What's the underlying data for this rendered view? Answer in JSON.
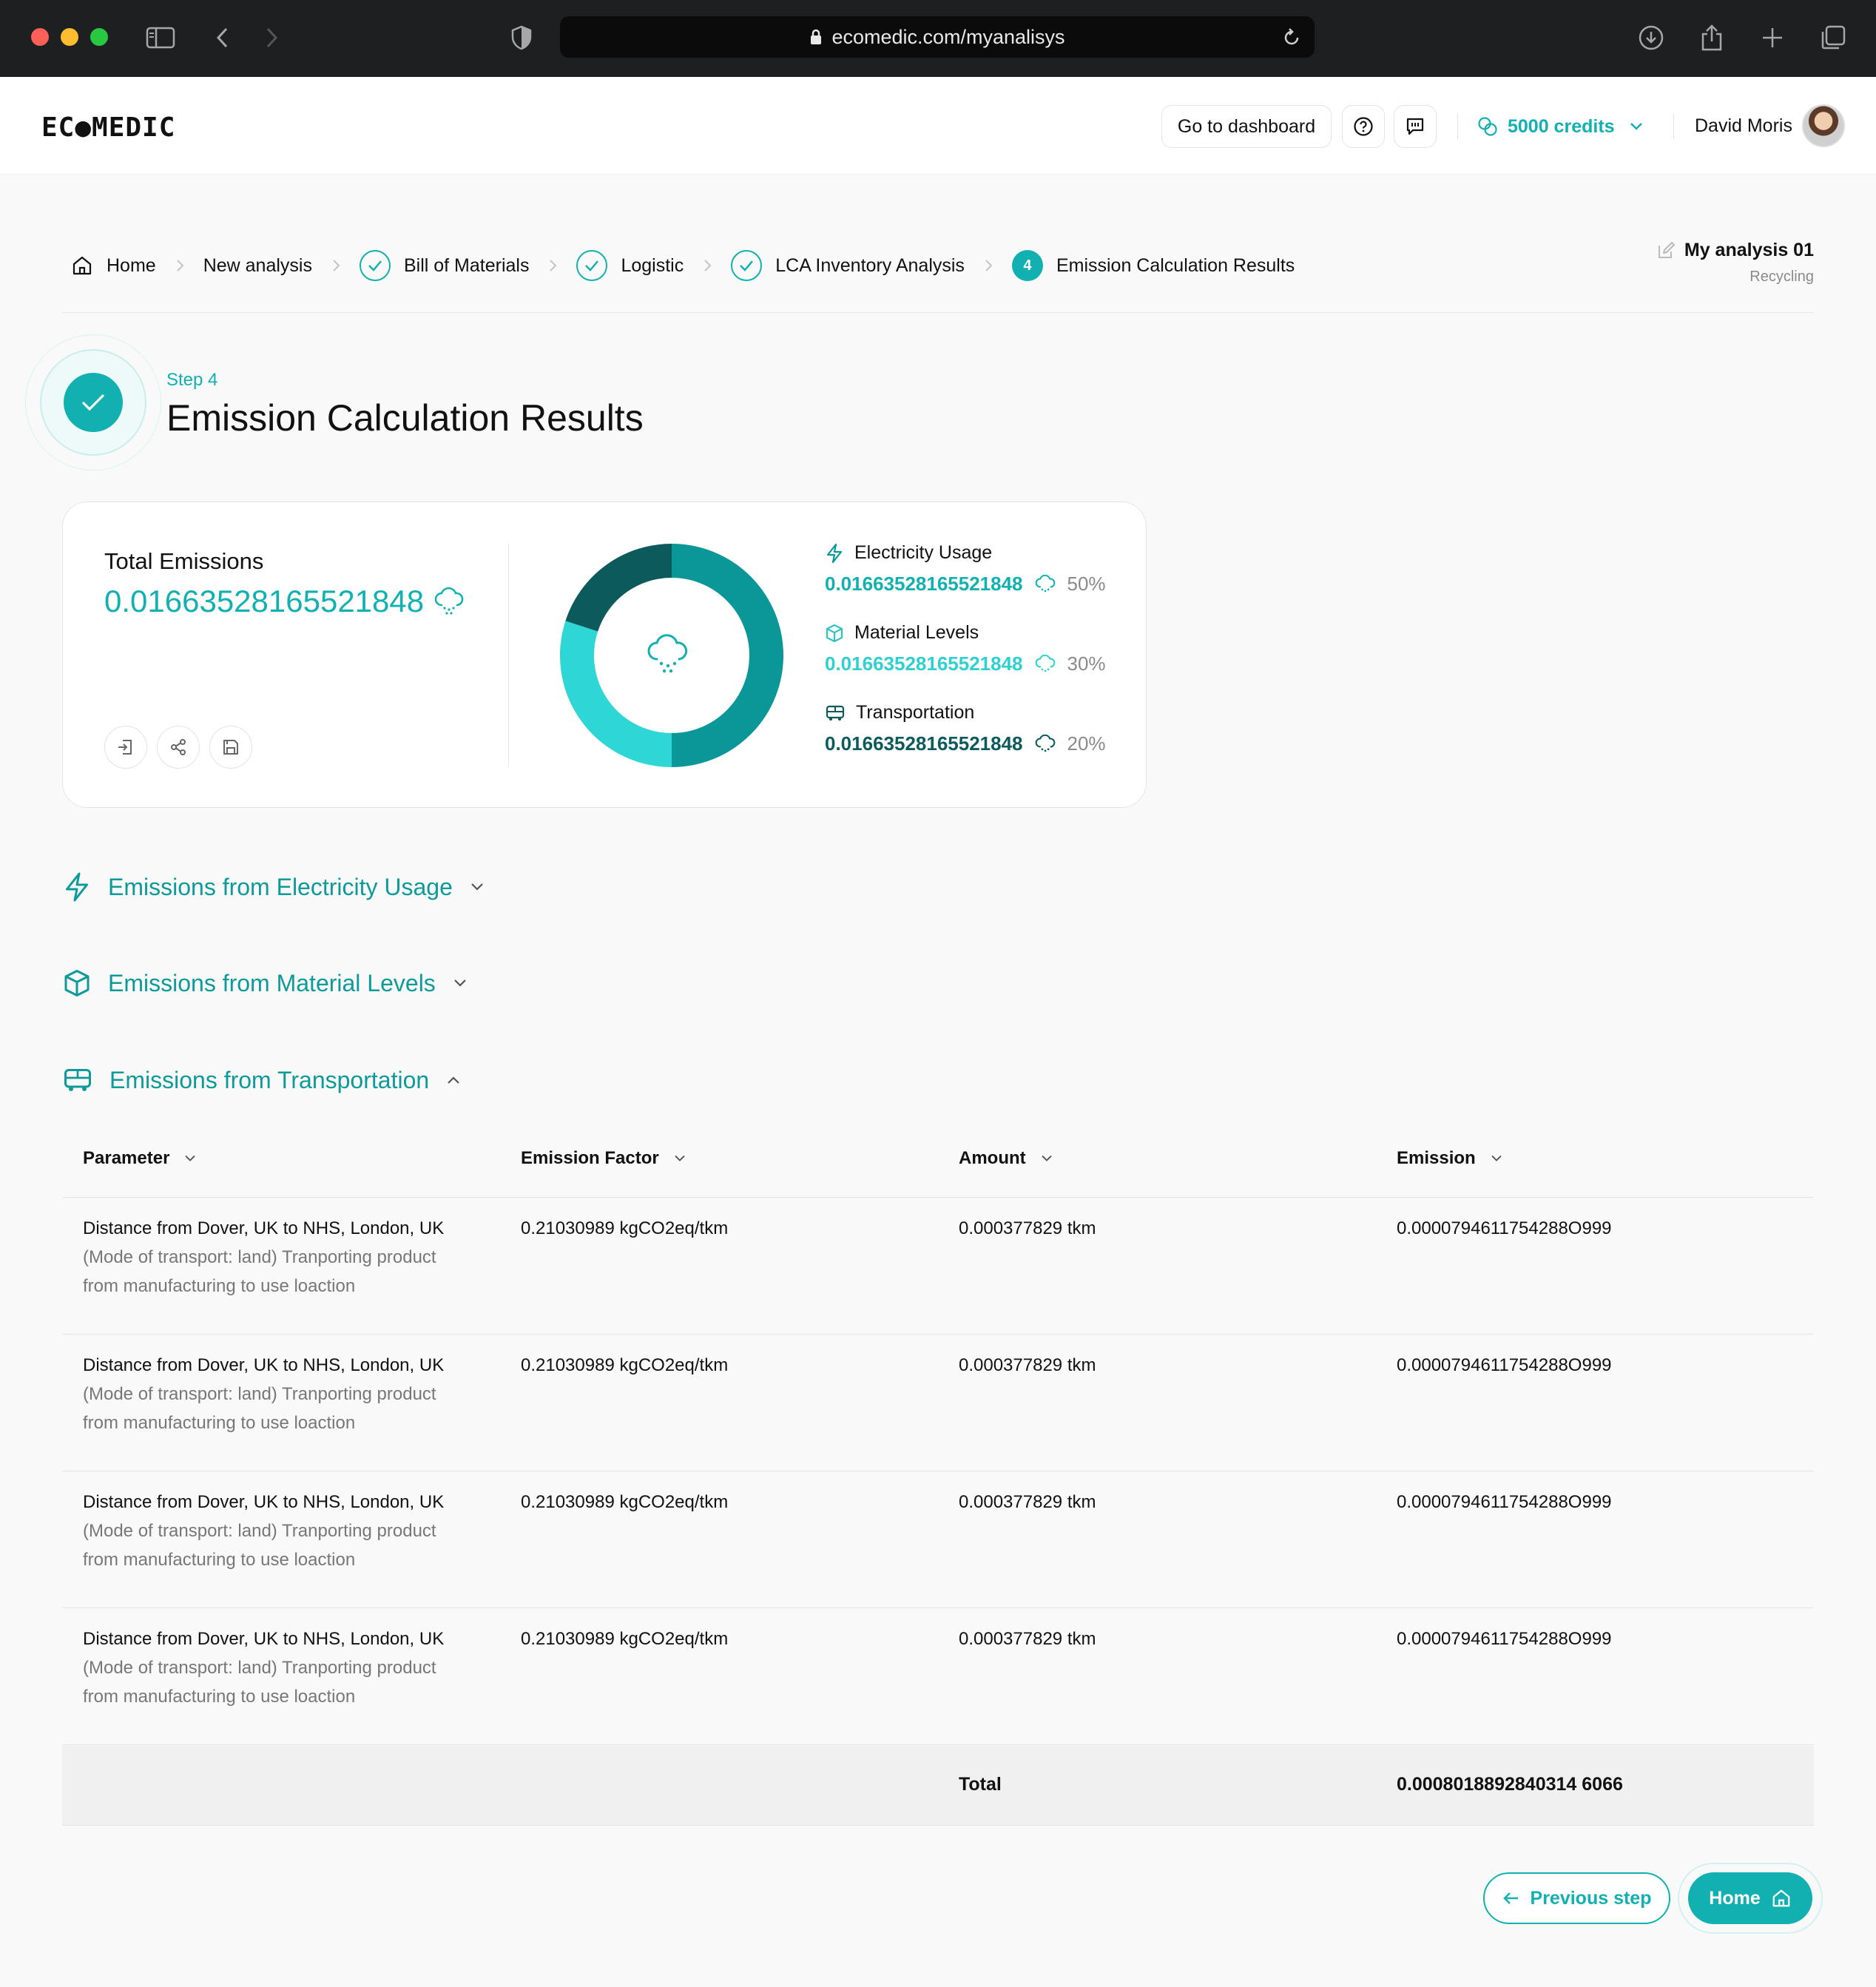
{
  "browser": {
    "url": "ecomedic.com/myanalisys"
  },
  "header": {
    "logo": "EC●MEDIC",
    "dashboard_button": "Go to dashboard",
    "credits": "5000 credits",
    "user_name": "David Moris"
  },
  "breadcrumb": {
    "items": [
      {
        "label": "Home",
        "state": "home"
      },
      {
        "label": "New analysis",
        "state": "plain"
      },
      {
        "label": "Bill of Materials",
        "state": "done"
      },
      {
        "label": "Logistic",
        "state": "done"
      },
      {
        "label": "LCA Inventory Analysis",
        "state": "done"
      },
      {
        "label": "Emission Calculation Results",
        "state": "current",
        "number": "4"
      }
    ],
    "analysis_name": "My analysis 01",
    "analysis_type": "Recycling"
  },
  "step": {
    "label": "Step 4",
    "title": "Emission Calculation Results"
  },
  "summary": {
    "total_label": "Total Emissions",
    "total_value": "0.01663528165521848",
    "breakdown": [
      {
        "name": "Electricity Usage",
        "value": "0.01663528165521848",
        "percent": "50%",
        "share": 0.5,
        "color": "#0b9797",
        "icon": "bolt-icon"
      },
      {
        "name": "Material Levels",
        "value": "0.01663528165521848",
        "percent": "30%",
        "share": 0.3,
        "color": "#2fd6d6",
        "icon": "cube-icon"
      },
      {
        "name": "Transportation",
        "value": "0.01663528165521848",
        "percent": "20%",
        "share": 0.2,
        "color": "#0d5a5d",
        "icon": "bus-icon"
      }
    ]
  },
  "sections": {
    "electricity": "Emissions from Electricity Usage",
    "material": "Emissions from Material Levels",
    "transportation": "Emissions from Transportation"
  },
  "table": {
    "headers": [
      "Parameter",
      "Emission Factor",
      "Amount",
      "Emission"
    ],
    "rows": [
      {
        "name": "Distance from Dover, UK to NHS, London, UK",
        "desc1": "(Mode of transport: land) Tranporting product",
        "desc2": "from manufacturing to use loaction",
        "factor": "0.21030989 kgCO2eq/tkm",
        "amount": "0.000377829 tkm",
        "emission": "0.0000794611754288O999"
      },
      {
        "name": "Distance from Dover, UK to NHS, London, UK",
        "desc1": "(Mode of transport: land) Tranporting product",
        "desc2": "from manufacturing to use loaction",
        "factor": "0.21030989 kgCO2eq/tkm",
        "amount": "0.000377829 tkm",
        "emission": "0.0000794611754288O999"
      },
      {
        "name": "Distance from Dover, UK to NHS, London, UK",
        "desc1": "(Mode of transport: land) Tranporting product",
        "desc2": "from manufacturing to use loaction",
        "factor": "0.21030989 kgCO2eq/tkm",
        "amount": "0.000377829 tkm",
        "emission": "0.0000794611754288O999"
      },
      {
        "name": "Distance from Dover, UK to NHS, London, UK",
        "desc1": "(Mode of transport: land) Tranporting product",
        "desc2": "from manufacturing to use loaction",
        "factor": "0.21030989 kgCO2eq/tkm",
        "amount": "0.000377829 tkm",
        "emission": "0.0000794611754288O999"
      }
    ],
    "total_label": "Total",
    "total_value": "0.0008018892840314 6066"
  },
  "footer": {
    "previous_button": "Previous step",
    "home_button": "Home"
  },
  "colors": {
    "accent": "#12b0b0",
    "accent_dark": "#0e8a8a"
  }
}
